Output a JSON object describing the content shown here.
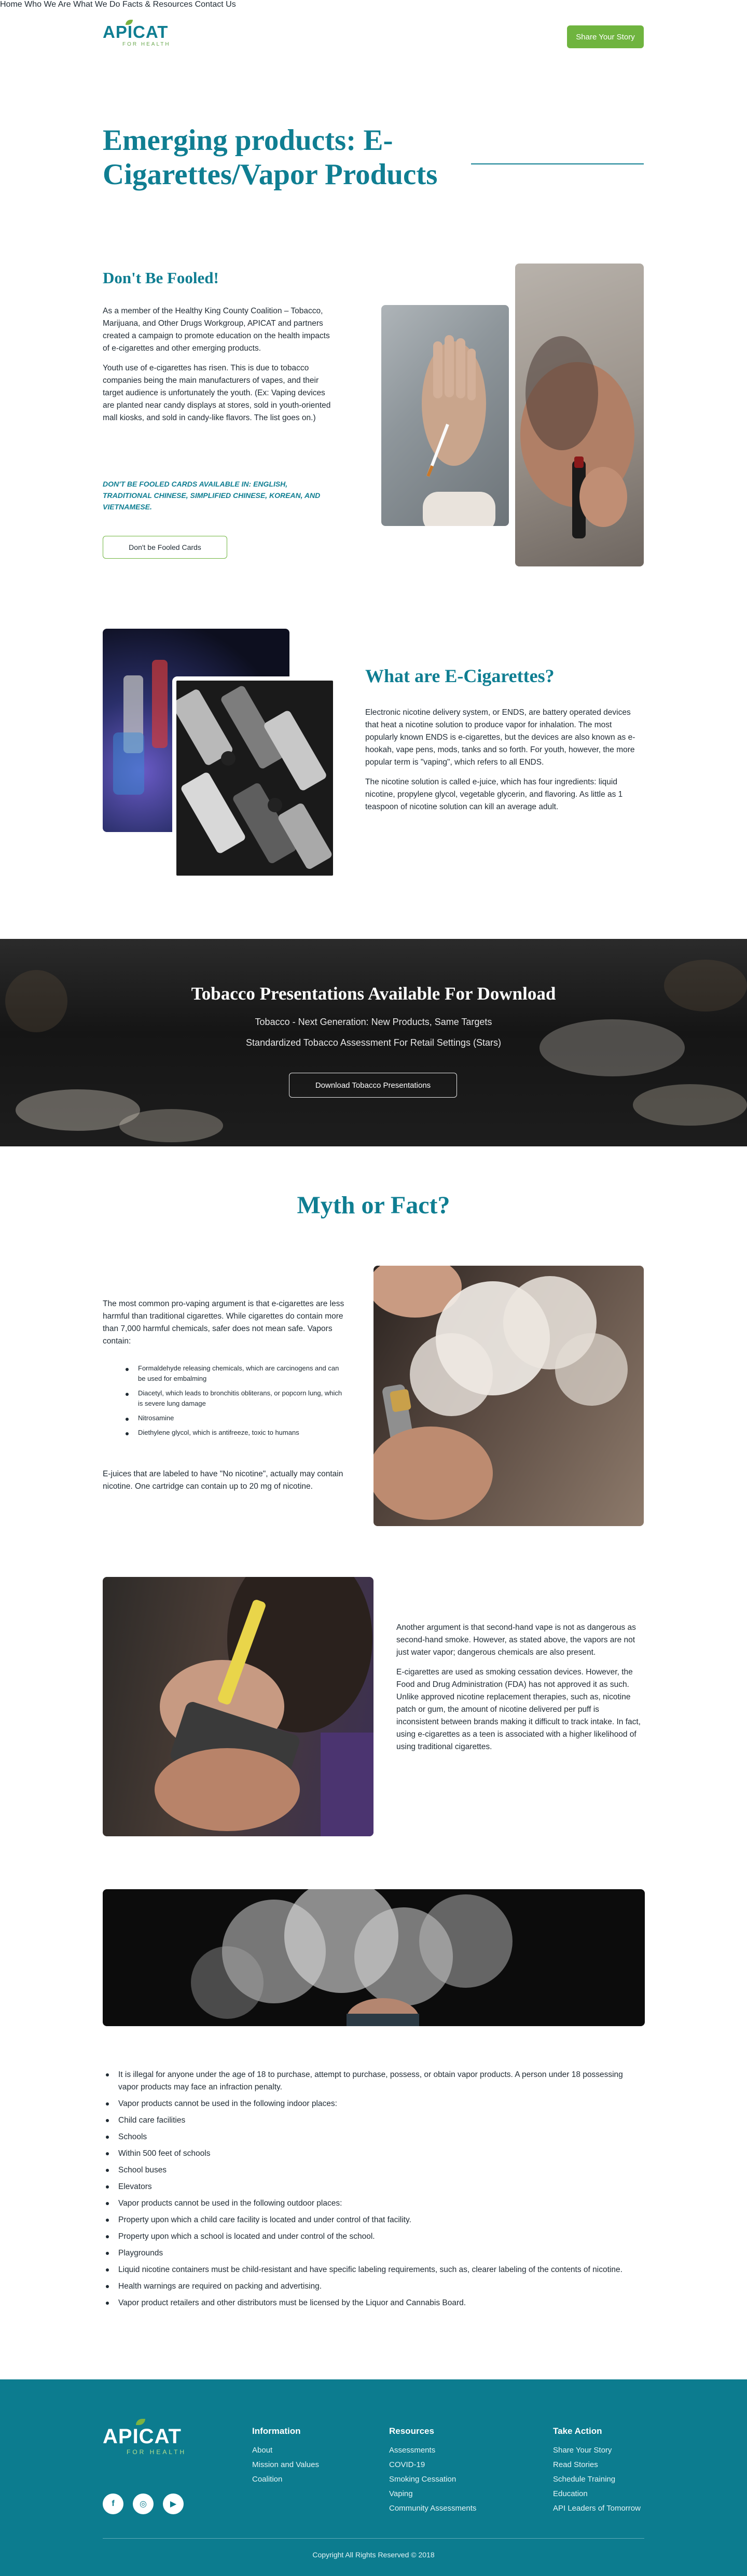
{
  "header": {
    "logo_word": "APICAT",
    "logo_tag": "FOR HEALTH",
    "nav": [
      "Home",
      "Who We Are",
      "What We Do",
      "Facts & Resources",
      "Contact Us"
    ],
    "cta": "Share Your Story"
  },
  "hero": {
    "title": "Emerging products: E-Cigarettes/Vapor Products"
  },
  "fooled": {
    "heading": "Don't Be Fooled!",
    "p1": "As a member of the Healthy King County Coalition – Tobacco, Marijuana, and Other Drugs Workgroup, APICAT and partners created a campaign to promote education on the health impacts of e-cigarettes and other emerging products.",
    "p2": "Youth use of e-cigarettes has risen. This is due to tobacco companies being the main manufacturers of vapes, and their target audience is unfortunately the youth. (Ex: Vaping devices are planted near candy displays at stores, sold in youth-oriented mall kiosks, and sold in candy-like flavors. The list goes on.)",
    "note": "DON'T BE FOOLED CARDS AVAILABLE IN: ENGLISH, TRADITIONAL CHINESE, SIMPLIFIED CHINESE, KOREAN, AND VIETNAMESE.",
    "button": "Don't be Fooled Cards"
  },
  "what": {
    "heading": "What are E-Cigarettes?",
    "p1": "Electronic nicotine delivery system, or ENDS, are battery operated devices that heat a nicotine solution to produce vapor for inhalation. The most popularly known ENDS is e-cigarettes, but the devices are also known as e-hookah, vape pens, mods, tanks and so forth. For youth, however, the more popular term is \"vaping\", which refers to all ENDS.",
    "p2": "The nicotine solution is called e-juice, which has four ingredients: liquid nicotine, propylene glycol, vegetable glycerin, and flavoring. As little as 1 teaspoon of nicotine solution can kill an average adult."
  },
  "banner": {
    "title": "Tobacco Presentations Available For Download",
    "line1": "Tobacco - Next Generation: New Products, Same Targets",
    "line2": "Standardized Tobacco Assessment For Retail Settings (Stars)",
    "button": "Download Tobacco Presentations"
  },
  "myth": {
    "heading": "Myth or Fact?",
    "p1": "The most common pro-vaping argument is that e-cigarettes are less harmful than traditional cigarettes. While cigarettes do contain more than 7,000 harmful chemicals, safer does not mean safe. Vapors contain:",
    "bullets": [
      "Formaldehyde releasing chemicals, which are carcinogens and can be used for embalming",
      "Diacetyl, which leads to bronchitis obliterans, or popcorn lung, which is severe lung damage",
      "Nitrosamine",
      "Diethylene glycol, which is antifreeze, toxic to humans"
    ],
    "p2": "E-juices that are labeled to have \"No nicotine\", actually may contain nicotine. One cartridge can contain up to 20 mg of nicotine.",
    "p3": "Another argument is that second-hand vape is not as dangerous as second-hand smoke. However, as stated above, the vapors are not just water vapor; dangerous chemicals are also present.",
    "p4": "E-cigarettes are used as smoking cessation devices. However, the Food and Drug Administration (FDA) has not approved it as such. Unlike approved nicotine replacement therapies, such as, nicotine patch or gum, the amount of nicotine delivered per puff is inconsistent between brands making it difficult to track intake. In fact, using e-cigarettes as a teen is associated with a higher likelihood of using traditional cigarettes."
  },
  "laws": [
    "It is illegal for anyone under the age of 18 to purchase, attempt to purchase, possess, or obtain vapor products. A person under 18 possessing vapor products may face an infraction penalty.",
    "Vapor products cannot be used in the following indoor places:",
    "Child care facilities",
    "Schools",
    "Within 500 feet of schools",
    "School buses",
    "Elevators",
    "Vapor products cannot be used in the following outdoor places:",
    "Property upon which a child care facility is located and under control of that facility.",
    "Property upon which a school is located and under control of the school.",
    "Playgrounds",
    "Liquid nicotine containers must be child-resistant and have specific labeling requirements, such as, clearer labeling of the contents of nicotine.",
    "Health warnings are required on packing and advertising.",
    "Vapor product retailers and other distributors must be licensed by the Liquor and Cannabis Board."
  ],
  "footer": {
    "logo_word": "APICAT",
    "logo_tag": "FOR HEALTH",
    "cols": [
      {
        "title": "Information",
        "links": [
          "About",
          "Mission and Values",
          "Coalition"
        ]
      },
      {
        "title": "Resources",
        "links": [
          "Assessments",
          "COVID-19",
          "Smoking Cessation",
          "Vaping",
          "Community Assessments"
        ]
      },
      {
        "title": "Take Action",
        "links": [
          "Share Your Story",
          "Read Stories",
          "Schedule Training",
          "Education",
          "API Leaders of Tomorrow"
        ]
      }
    ],
    "social": [
      "f",
      "◎",
      "▶"
    ],
    "copyright": "Copyright All Rights Reserved © 2018"
  },
  "colors": {
    "brand": "#0f7e92",
    "accent": "#6fb43f",
    "footer": "#0c7c8f"
  }
}
